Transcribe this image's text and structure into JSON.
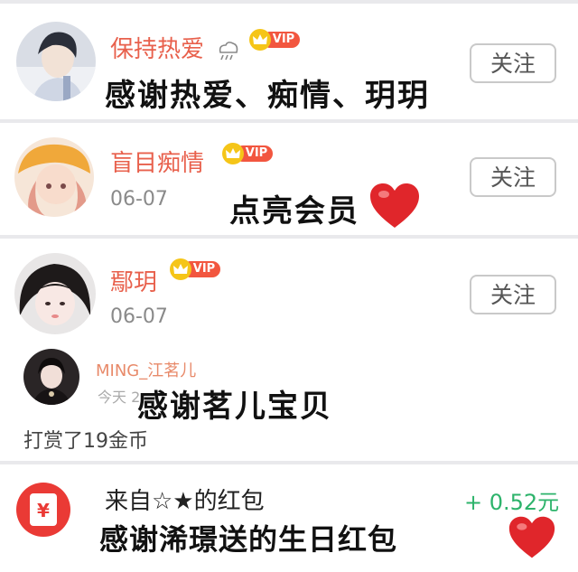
{
  "follow_label": "关注",
  "vip_label": "VIP",
  "users": [
    {
      "name": "保持热爱",
      "caption": "感谢热爱、痴情、玥玥"
    },
    {
      "name": "盲目痴情",
      "date": "06-07",
      "caption": "点亮会员"
    },
    {
      "name": "鄢玥",
      "date": "06-07"
    }
  ],
  "gift": {
    "name": "MING_江茗儿",
    "time": "今天 2",
    "caption": "感谢茗儿宝贝",
    "text": "打赏了19金币"
  },
  "red_packet": {
    "icon_text": "¥",
    "from": "来自☆★的红包",
    "amount": "+ 0.52元",
    "caption": "感谢浠璟送的生日红包"
  },
  "colors": {
    "name": "#e8604c",
    "vip": "#f2563f",
    "crown": "#f5c518",
    "heart": "#e0262b",
    "amount": "#2db36b"
  }
}
